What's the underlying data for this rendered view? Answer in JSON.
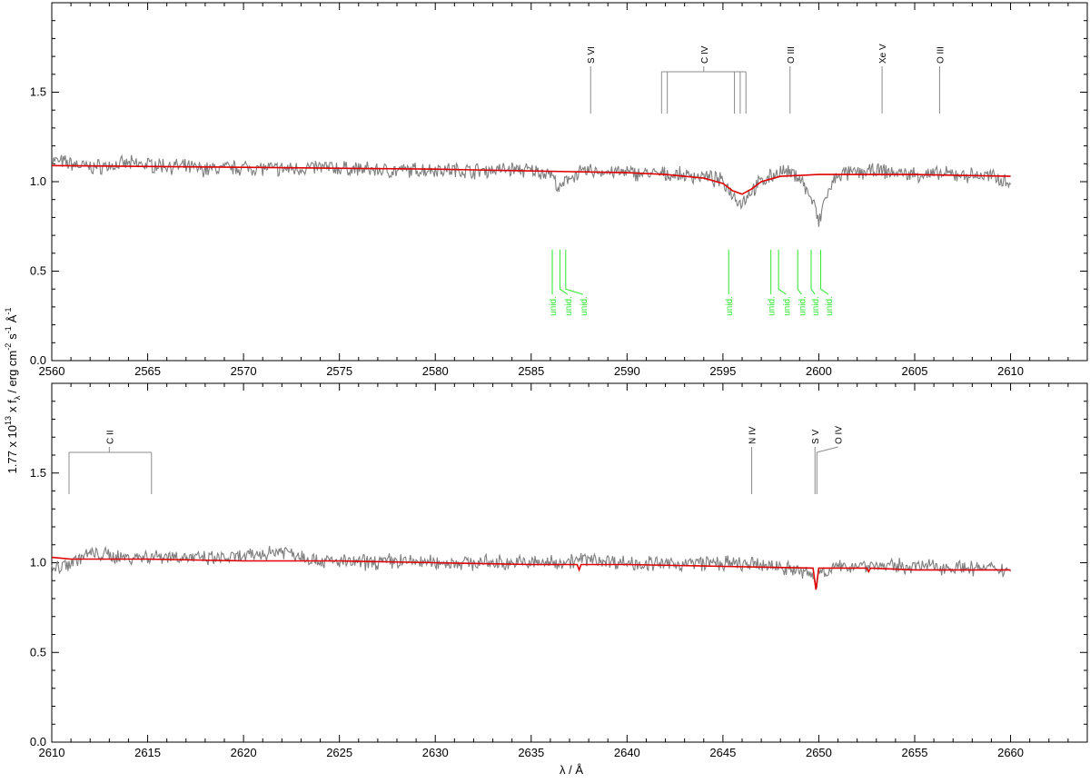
{
  "colors": {
    "observed": "#7f7f7f",
    "model": "#e00000",
    "ident_known": "#8c8c8c",
    "ident_unknown": "#2ee62e",
    "axis": "#000000"
  },
  "ylabel": "1.77 x 10",
  "ylabel_exp": "13",
  "ylabel_rest": "x f",
  "ylabel_sub": "λ",
  "ylabel_units": "/ erg cm",
  "ylabel_units_exp": "-2",
  "ylabel_s": "s",
  "ylabel_s_exp": "-1",
  "ylabel_A": "Å",
  "ylabel_A_exp": "-1",
  "xlabel": "λ / Å",
  "chart_data": [
    {
      "type": "line",
      "panel": "upper",
      "xlabel": "λ / Å",
      "ylabel": "1.77 x 10^13 x f_λ / erg cm^-2 s^-1 Å^-1",
      "xlim": [
        2560,
        2614
      ],
      "ylim": [
        0.0,
        2.0
      ],
      "grid": false,
      "x_ticks": [
        "2560",
        "2565",
        "2570",
        "2575",
        "2580",
        "2585",
        "2590",
        "2595",
        "2600",
        "2605",
        "2610"
      ],
      "y_ticks": [
        "0.0",
        "0.5",
        "1.0",
        "1.5"
      ],
      "series": [
        {
          "role": "observed",
          "x": [
            2560,
            2562,
            2564,
            2566,
            2568,
            2570,
            2572,
            2574,
            2576,
            2578,
            2580,
            2582,
            2584,
            2586,
            2586.5,
            2587,
            2588,
            2590,
            2592,
            2594,
            2595,
            2595.6,
            2596,
            2596.3,
            2597,
            2598,
            2599,
            2599.8,
            2600,
            2600.3,
            2601,
            2603,
            2605,
            2607,
            2609,
            2610
          ],
          "y": [
            1.12,
            1.08,
            1.1,
            1.09,
            1.07,
            1.08,
            1.07,
            1.08,
            1.07,
            1.06,
            1.07,
            1.06,
            1.07,
            1.05,
            0.95,
            1.03,
            1.06,
            1.05,
            1.04,
            1.03,
            1.0,
            0.92,
            0.88,
            0.93,
            1.0,
            1.06,
            1.03,
            0.86,
            0.76,
            0.9,
            1.04,
            1.06,
            1.04,
            1.04,
            1.03,
            1.0
          ]
        },
        {
          "role": "model",
          "x": [
            2560,
            2570,
            2580,
            2585,
            2590,
            2592,
            2594,
            2595,
            2595.5,
            2596,
            2596.5,
            2597,
            2598,
            2600,
            2605,
            2610
          ],
          "y": [
            1.09,
            1.08,
            1.07,
            1.06,
            1.05,
            1.04,
            1.02,
            0.99,
            0.95,
            0.93,
            0.96,
            1.0,
            1.03,
            1.04,
            1.04,
            1.03
          ]
        }
      ],
      "identifications": [
        {
          "label": "S VI",
          "x": [
            2588.1
          ],
          "group_x": 2588.1,
          "kind": "known"
        },
        {
          "label": "C IV",
          "x": [
            2591.8,
            2592.1,
            2595.6,
            2595.9,
            2596.2
          ],
          "group_x": 2594.0,
          "kind": "known"
        },
        {
          "label": "O III",
          "x": [
            2598.5
          ],
          "group_x": 2598.5,
          "kind": "known"
        },
        {
          "label": "Xe V",
          "x": [
            2603.3
          ],
          "group_x": 2603.3,
          "kind": "known"
        },
        {
          "label": "O III",
          "x": [
            2606.3
          ],
          "group_x": 2606.3,
          "kind": "known"
        }
      ],
      "unidentified": {
        "label": "unid.",
        "x": [
          2586.1,
          2586.5,
          2586.8,
          2595.3,
          2597.5,
          2597.9,
          2598.9,
          2599.6,
          2600.1
        ],
        "label_x": [
          2586.1,
          2586.9,
          2587.7,
          2595.3,
          2597.5,
          2598.3,
          2599.1,
          2599.8,
          2600.5
        ]
      }
    },
    {
      "type": "line",
      "panel": "lower",
      "xlabel": "λ / Å",
      "ylabel": "1.77 x 10^13 x f_λ / erg cm^-2 s^-1 Å^-1",
      "xlim": [
        2610,
        2664
      ],
      "ylim": [
        0.0,
        2.0
      ],
      "grid": false,
      "x_ticks": [
        "2610",
        "2615",
        "2620",
        "2625",
        "2630",
        "2635",
        "2640",
        "2645",
        "2650",
        "2655",
        "2660"
      ],
      "y_ticks": [
        "0.0",
        "0.5",
        "1.0",
        "1.5"
      ],
      "series": [
        {
          "role": "observed",
          "x": [
            2610,
            2612,
            2614,
            2616,
            2618,
            2620,
            2622,
            2624,
            2626,
            2628,
            2630,
            2632,
            2634,
            2636,
            2638,
            2640,
            2642,
            2644,
            2646,
            2648,
            2649.7,
            2649.85,
            2650,
            2652,
            2654,
            2656,
            2658,
            2660
          ],
          "y": [
            0.96,
            1.05,
            1.03,
            1.04,
            1.02,
            1.03,
            1.07,
            1.01,
            1.0,
            1.01,
            1.0,
            1.0,
            1.0,
            1.0,
            1.02,
            1.0,
            0.99,
            1.0,
            0.99,
            0.98,
            0.93,
            0.86,
            0.95,
            0.99,
            0.98,
            0.98,
            0.97,
            0.96
          ]
        },
        {
          "role": "model",
          "x": [
            2610,
            2611,
            2615,
            2620,
            2625,
            2630,
            2635,
            2637.4,
            2637.5,
            2637.6,
            2640,
            2645,
            2649.7,
            2649.85,
            2650,
            2652.5,
            2652.6,
            2652.7,
            2655,
            2660
          ],
          "y": [
            1.03,
            1.02,
            1.02,
            1.01,
            1.01,
            1.0,
            0.99,
            0.99,
            0.96,
            0.99,
            0.99,
            0.98,
            0.97,
            0.85,
            0.97,
            0.97,
            0.95,
            0.97,
            0.96,
            0.96
          ]
        }
      ],
      "identifications": [
        {
          "label": "C II",
          "x": [
            2610.9,
            2615.2
          ],
          "group_x": 2613.0,
          "kind": "known"
        },
        {
          "label": "N IV",
          "x": [
            2646.5
          ],
          "group_x": 2646.5,
          "kind": "known"
        },
        {
          "label": "S V",
          "x": [
            2649.8
          ],
          "group_x": 2649.8,
          "kind": "known"
        },
        {
          "label": "O IV",
          "x": [
            2649.9
          ],
          "group_x": 2651.0,
          "kind": "known"
        }
      ]
    }
  ]
}
